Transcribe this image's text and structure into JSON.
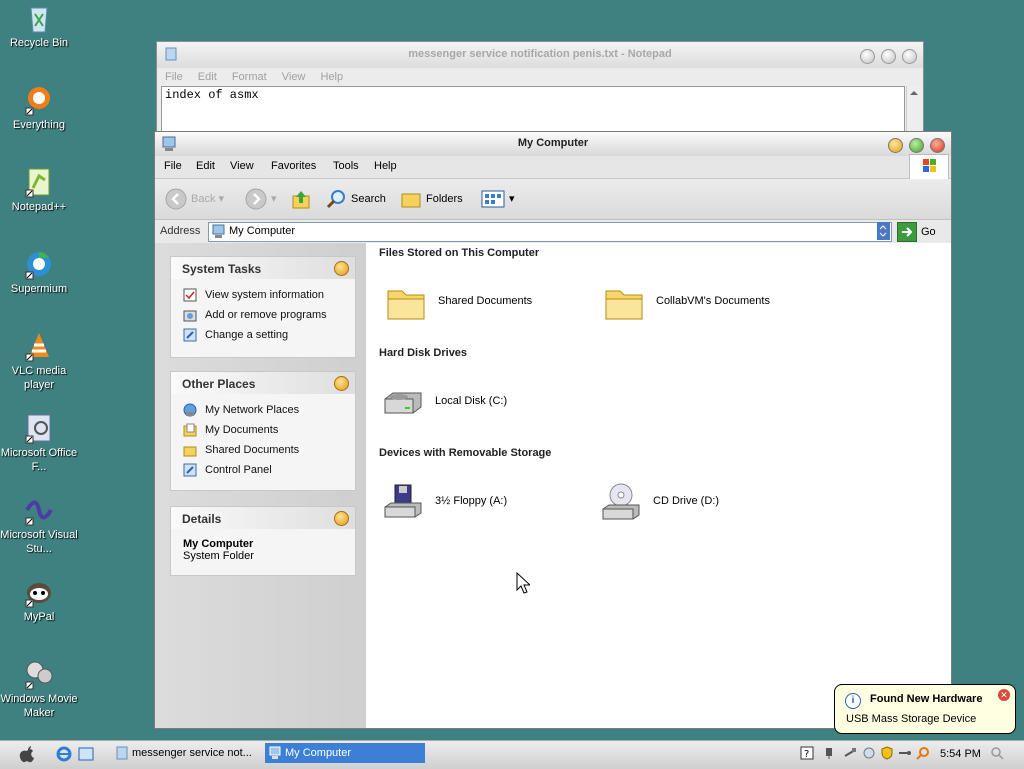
{
  "desktop": {
    "icons": [
      {
        "label": "Recycle Bin",
        "icon": "recycle-bin-icon"
      },
      {
        "label": "Everything",
        "icon": "everything-search-icon"
      },
      {
        "label": "Notepad++",
        "icon": "notepad-plus-plus-icon"
      },
      {
        "label": "Supermium",
        "icon": "supermium-browser-icon"
      },
      {
        "label": "VLC media player",
        "icon": "vlc-icon"
      },
      {
        "label": "Microsoft Office F...",
        "icon": "office-icon"
      },
      {
        "label": "Microsoft Visual Stu...",
        "icon": "visual-studio-icon"
      },
      {
        "label": "MyPal",
        "icon": "mypal-browser-icon"
      },
      {
        "label": "Windows Movie Maker",
        "icon": "movie-maker-icon"
      }
    ]
  },
  "notepad": {
    "title": "messenger service notification penis.txt - Notepad",
    "menu": [
      "File",
      "Edit",
      "Format",
      "View",
      "Help"
    ],
    "text_line1": "index of asmx"
  },
  "mycomputer": {
    "title": "My Computer",
    "menu": [
      "File",
      "Edit",
      "View",
      "Favorites",
      "Tools",
      "Help"
    ],
    "toolbar": {
      "back": "Back",
      "search": "Search",
      "folders": "Folders"
    },
    "address": {
      "label": "Address",
      "value": "My Computer",
      "go": "Go"
    },
    "system_tasks": {
      "title": "System Tasks",
      "items": [
        "View system information",
        "Add or remove programs",
        "Change a setting"
      ]
    },
    "other_places": {
      "title": "Other Places",
      "items": [
        "My Network Places",
        "My Documents",
        "Shared Documents",
        "Control Panel"
      ]
    },
    "details": {
      "title": "Details",
      "name": "My Computer",
      "type": "System Folder"
    },
    "sections": {
      "files": "Files Stored on This Computer",
      "hdd": "Hard Disk Drives",
      "removable": "Devices with Removable Storage"
    },
    "items": {
      "shared_docs": "Shared Documents",
      "collab_docs": "CollabVM's Documents",
      "local_disk": "Local Disk (C:)",
      "floppy": "3½ Floppy (A:)",
      "cd": "CD Drive (D:)"
    }
  },
  "balloon": {
    "title": "Found New Hardware",
    "body": "USB Mass Storage Device"
  },
  "taskbar": {
    "tasks": [
      "messenger service not...",
      "My Computer"
    ],
    "clock": "5:54 PM"
  },
  "colors": {
    "desktop": "#3f8080",
    "taskbar_active": "#3c7fd6"
  }
}
